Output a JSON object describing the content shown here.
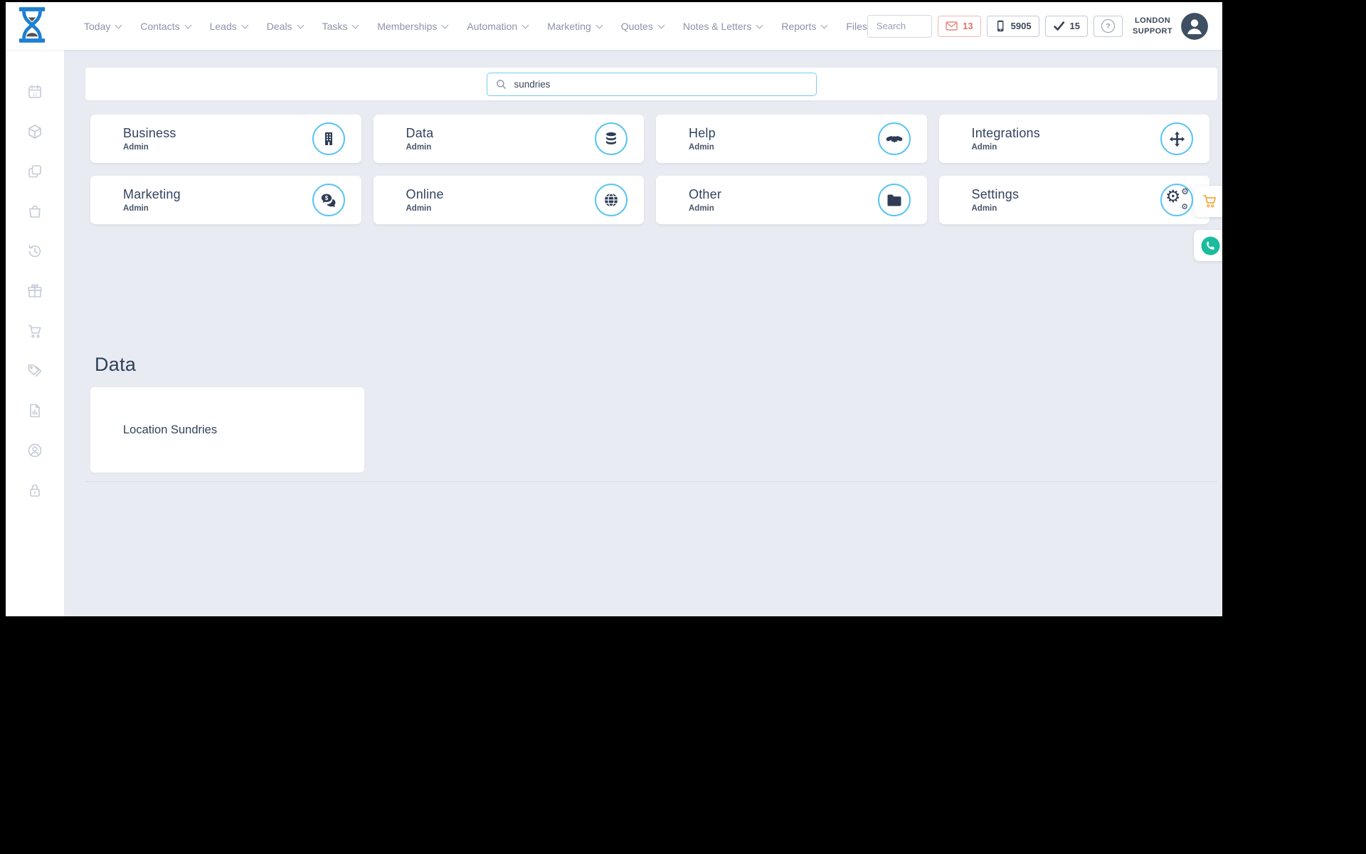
{
  "header": {
    "nav": [
      {
        "label": "Today",
        "caret": true
      },
      {
        "label": "Contacts",
        "caret": true
      },
      {
        "label": "Leads",
        "caret": true
      },
      {
        "label": "Deals",
        "caret": true
      },
      {
        "label": "Tasks",
        "caret": true
      },
      {
        "label": "Memberships",
        "caret": true
      },
      {
        "label": "Automation",
        "caret": true
      },
      {
        "label": "Marketing",
        "caret": true
      },
      {
        "label": "Quotes",
        "caret": true
      },
      {
        "label": "Notes & Letters",
        "caret": true
      },
      {
        "label": "Reports",
        "caret": true
      },
      {
        "label": "Files",
        "caret": false
      }
    ],
    "search": {
      "placeholder": "Search"
    },
    "badges": {
      "messages": "13",
      "calls": "5905",
      "tasks": "15",
      "help": "?"
    },
    "user": {
      "line1": "LONDON",
      "line2": "SUPPORT"
    }
  },
  "page": {
    "search_value": "sundries",
    "categories": [
      {
        "title": "Business",
        "subtitle": "Admin",
        "icon": "building-icon"
      },
      {
        "title": "Data",
        "subtitle": "Admin",
        "icon": "database-icon"
      },
      {
        "title": "Help",
        "subtitle": "Admin",
        "icon": "handshake-icon"
      },
      {
        "title": "Integrations",
        "subtitle": "Admin",
        "icon": "move-arrows-icon"
      },
      {
        "title": "Marketing",
        "subtitle": "Admin",
        "icon": "comments-dollar-icon"
      },
      {
        "title": "Online",
        "subtitle": "Admin",
        "icon": "globe-icon"
      },
      {
        "title": "Other",
        "subtitle": "Admin",
        "icon": "folder-icon"
      },
      {
        "title": "Settings",
        "subtitle": "Admin",
        "icon": "gears-icon"
      }
    ],
    "results": {
      "heading": "Data",
      "items": [
        {
          "label": "Location Sundries"
        }
      ]
    }
  },
  "sidebar": {
    "icons": [
      "calendar-icon",
      "package-icon",
      "copy-icon",
      "bag-icon",
      "history-icon",
      "gift-icon",
      "cart-icon",
      "tags-icon",
      "report-icon",
      "account-icon",
      "lock-icon"
    ]
  },
  "floating": {
    "icons": [
      "cart-icon",
      "whatsapp-icon"
    ]
  },
  "colors": {
    "accent_blue": "#59c4f1",
    "navy": "#2e3d55",
    "nav_gray": "#8d92aa",
    "salmon": "#e8706a",
    "orange": "#f5a83a",
    "teal": "#1abc9c",
    "background": "#e9ebf3",
    "logo_blue": "#1c7fd2"
  }
}
